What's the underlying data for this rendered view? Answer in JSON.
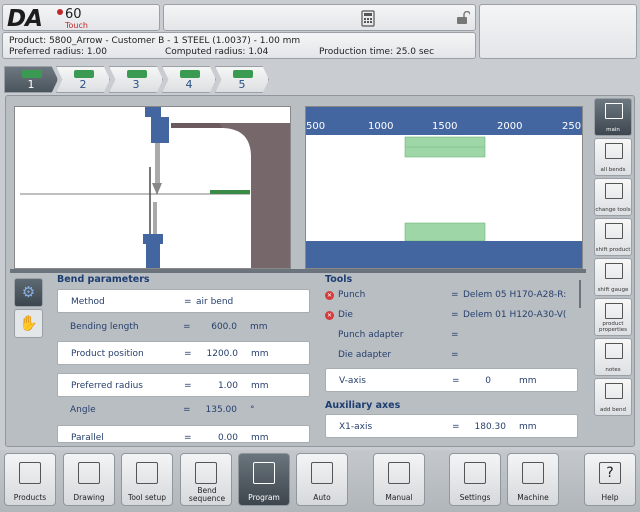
{
  "brand": {
    "name": "DA",
    "model": "60",
    "variant": "Touch"
  },
  "info": {
    "product": "Product: 5800_Arrow - Customer B - 1 STEEL (1.0037) - 1.00 mm",
    "preferred_radius": "Preferred radius: 1.00",
    "computed_radius": "Computed radius: 1.04",
    "production_time": "Production time: 25.0 sec"
  },
  "bend_tabs": [
    "1",
    "2",
    "3",
    "4",
    "5"
  ],
  "ruler": [
    "500",
    "1000",
    "1500",
    "2000",
    "250"
  ],
  "sidebar": [
    "main",
    "all bends",
    "change tools",
    "shift product",
    "shift gauge",
    "product properties",
    "notes",
    "add bend"
  ],
  "bend_parameters": {
    "title": "Bend parameters",
    "rows": [
      {
        "label": "Method",
        "eq": "=",
        "value": "air bend",
        "unit": ""
      },
      {
        "label": "Bending length",
        "eq": "=",
        "value": "600.0",
        "unit": "mm"
      },
      {
        "label": "Product position",
        "eq": "=",
        "value": "1200.0",
        "unit": "mm"
      },
      {
        "label": "Preferred radius",
        "eq": "=",
        "value": "1.00",
        "unit": "mm"
      },
      {
        "label": "Angle",
        "eq": "=",
        "value": "135.00",
        "unit": "°"
      },
      {
        "label": "Parallel",
        "eq": "=",
        "value": "0.00",
        "unit": "mm"
      }
    ]
  },
  "tools": {
    "title": "Tools",
    "rows": [
      {
        "label": "Punch",
        "eq": "=",
        "value": "Delem 05 H170-A28-R:"
      },
      {
        "label": "Die",
        "eq": "=",
        "value": "Delem 01 H120-A30-V("
      },
      {
        "label": "Punch adapter",
        "eq": "=",
        "value": ""
      },
      {
        "label": "Die adapter",
        "eq": "=",
        "value": ""
      },
      {
        "label": "V-axis",
        "eq": "=",
        "value": "0",
        "unit": "mm"
      }
    ]
  },
  "aux": {
    "title": "Auxiliary axes",
    "rows": [
      {
        "label": "X1-axis",
        "eq": "=",
        "value": "180.30",
        "unit": "mm"
      }
    ]
  },
  "bottom_nav": [
    "Products",
    "Drawing",
    "Tool setup",
    "Bend sequence",
    "Program",
    "Auto",
    "Manual",
    "Settings",
    "Machine",
    "Help"
  ],
  "colors": {
    "accent": "#4466a0",
    "active": "#3e474f",
    "ok": "#3a9a52",
    "error": "#d63a3a"
  }
}
